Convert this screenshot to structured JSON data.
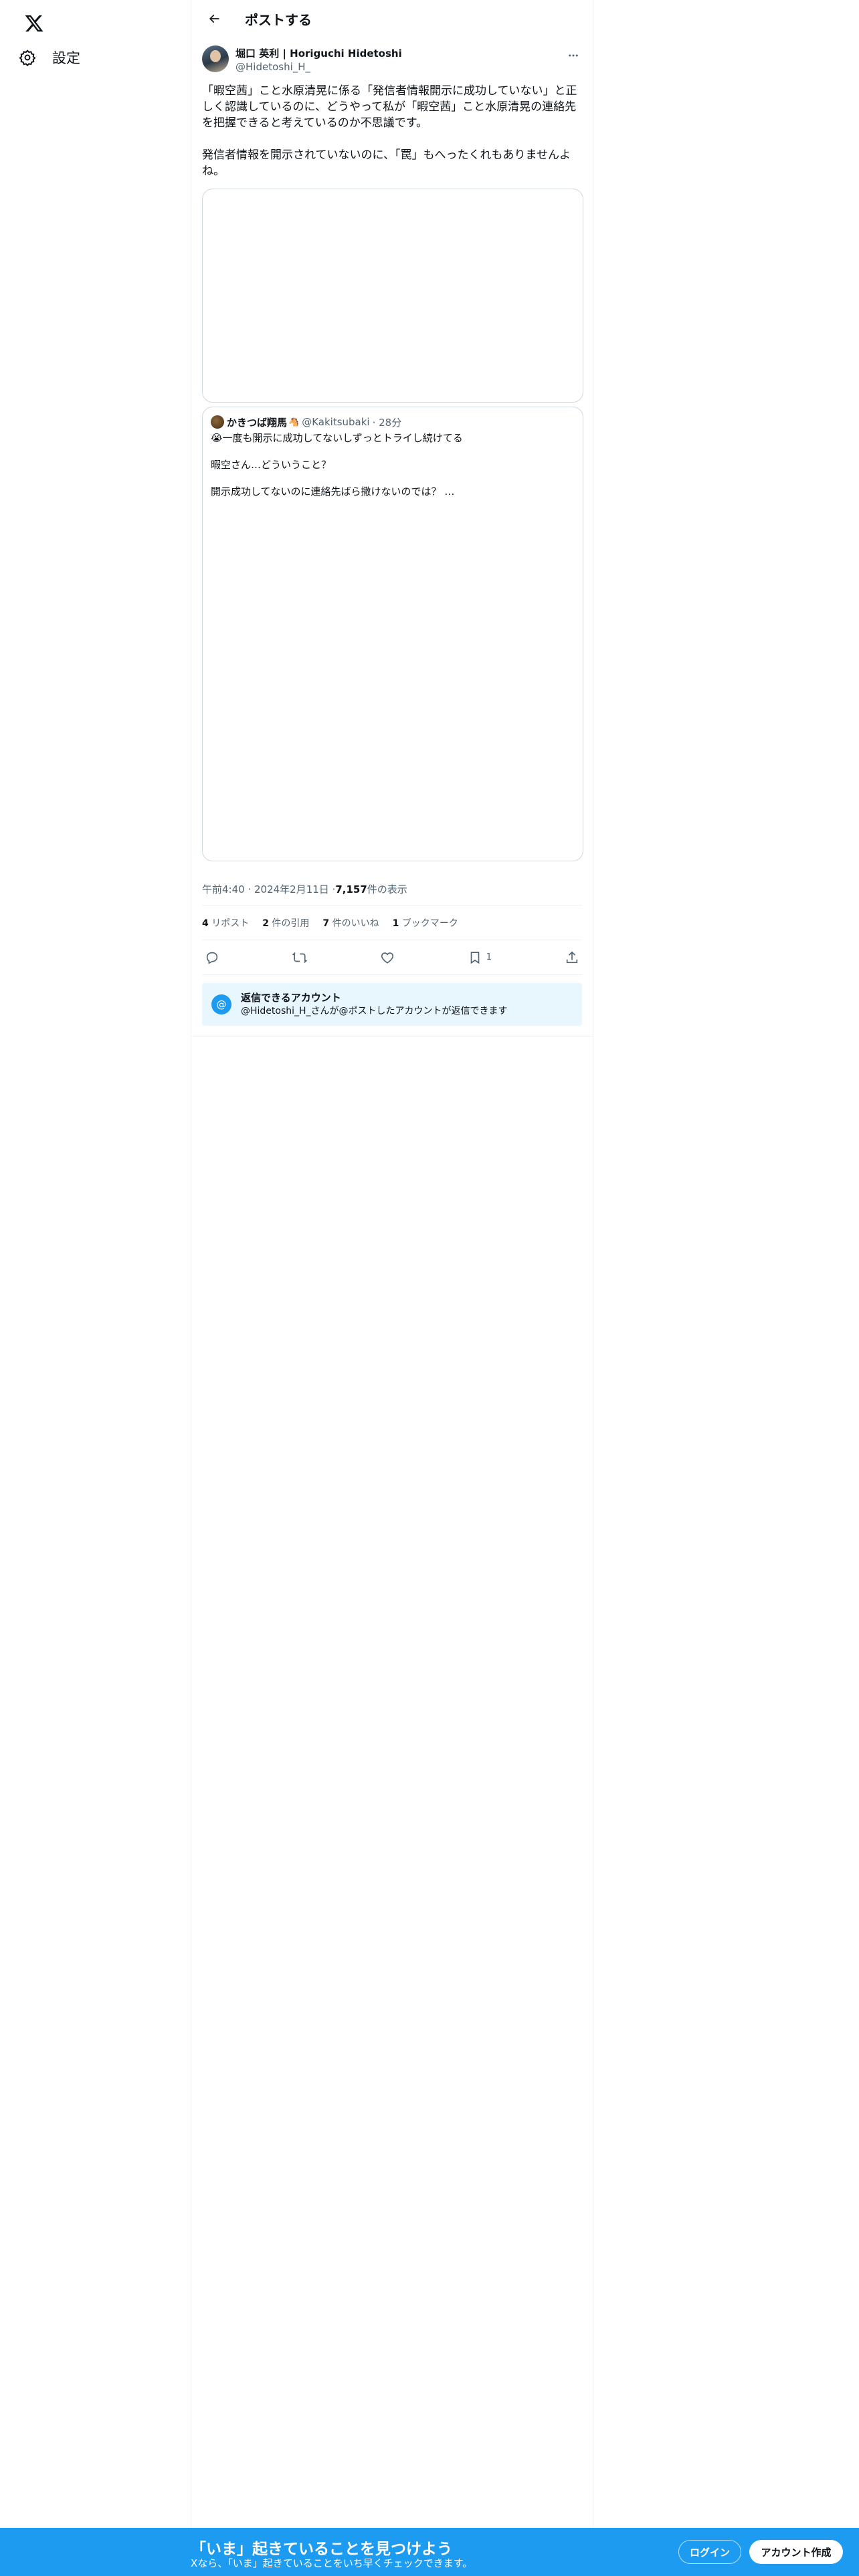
{
  "nav": {
    "logo_icon": "x-logo-icon",
    "settings_label": "設定",
    "settings_icon": "gear-icon"
  },
  "header": {
    "back_icon": "arrow-left-icon",
    "title": "ポストする"
  },
  "post": {
    "author_name": "堀口 英利 | Horiguchi Hidetoshi",
    "author_handle": "@Hidetoshi_H_",
    "text": "「暇空茜」こと水原清晃に係る「発信者情報開示に成功していない」と正しく認識しているのに、どうやって私が「暇空茜」こと水原清晃の連絡先を把握できると考えているのか不思議です。\n\n発信者情報を開示されていないのに、「罠」もへったくれもありませんよね。",
    "quote": {
      "name": "かきつば翔馬",
      "badge": "🐴",
      "handle": "@Kakitsubaki",
      "time": "· 28分",
      "text": "😭一度も開示に成功してないしずっとトライし続けてる\n\n暇空さん…どういうこと？\n\n開示成功してないのに連絡先ばら撒けないのでは？ …"
    },
    "timestamp": "午前4:40 · 2024年2月11日 · ",
    "views_count": "7,157",
    "views_label": " 件の表示",
    "stats": {
      "reposts_count": "4",
      "reposts_label": " リポスト",
      "quotes_count": "2",
      "quotes_label": " 件の引用",
      "likes_count": "7",
      "likes_label": " 件のいいね",
      "bookmarks_count": "1",
      "bookmarks_label": " ブックマーク"
    },
    "actions": {
      "bookmark_count": "1"
    },
    "reply_notice": {
      "title": "返信できるアカウント",
      "desc": "@Hidetoshi_H_さんが@ポストしたアカウントが返信できます"
    }
  },
  "bottom_bar": {
    "title": "「いま」起きていることを見つけよう",
    "subtitle": "Xなら、「いま」起きていることをいち早くチェックできます。",
    "login_label": "ログイン",
    "signup_label": "アカウント作成",
    "bg_color": "#1d9bf0"
  }
}
